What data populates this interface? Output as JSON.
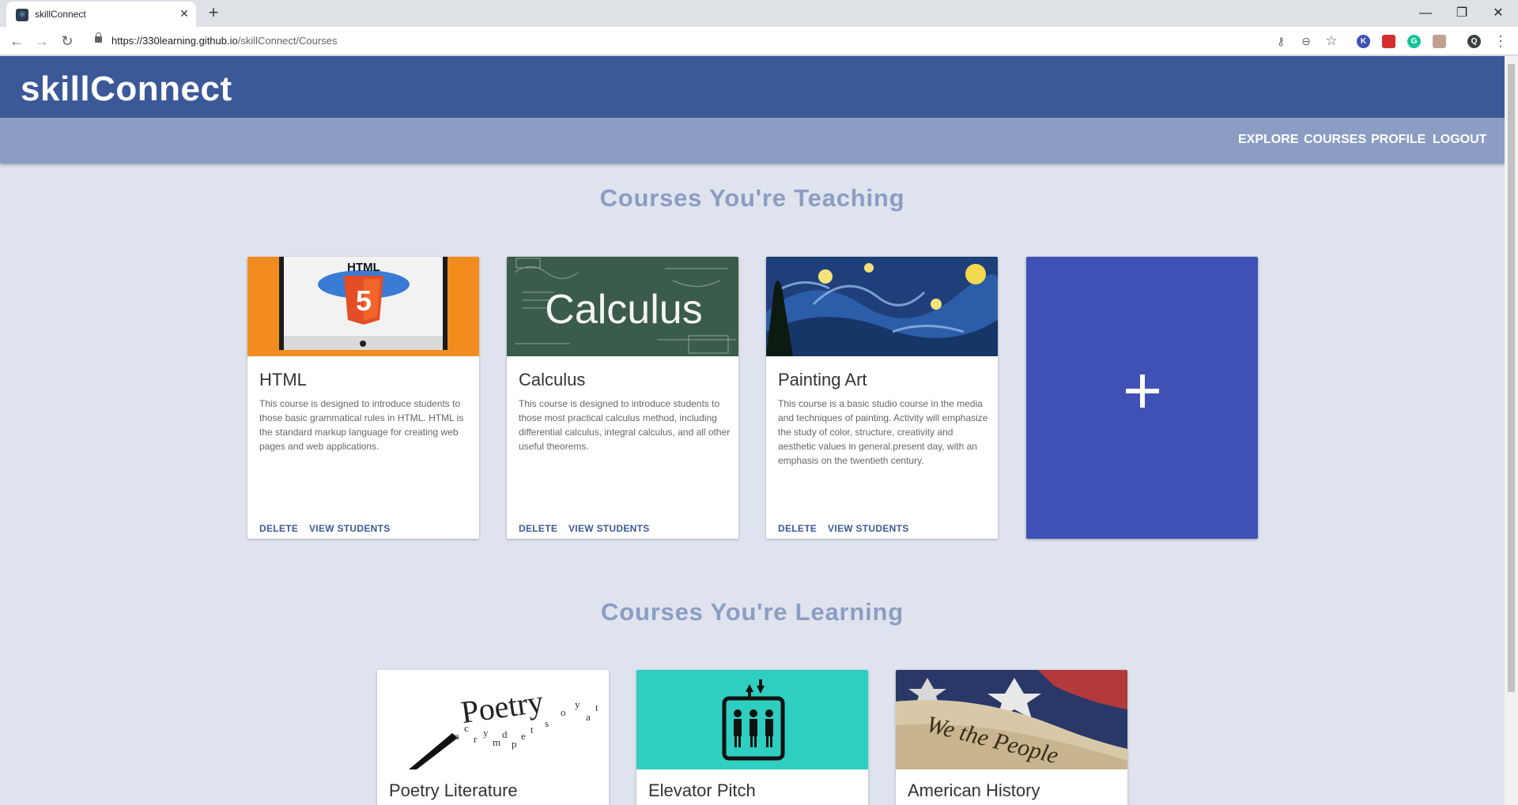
{
  "browser": {
    "tab_title": "skillConnect",
    "tab_close": "✕",
    "new_tab": "+",
    "url_domain": "https://330learning.github.io",
    "url_path": "/skillConnect/Courses",
    "window_controls": {
      "minimize": "—",
      "restore": "❐",
      "close": "✕"
    },
    "extensions": [
      {
        "label": "K",
        "color": "#3f51b5"
      },
      {
        "label": "",
        "color": "#d32f2f"
      },
      {
        "label": "G",
        "color": "#15c39a"
      },
      {
        "label": "",
        "color": "#c0a090"
      },
      {
        "label": "Q",
        "color": "#3c4043"
      }
    ]
  },
  "header": {
    "brand": "skillConnect",
    "menu": [
      "EXPLORE",
      "COURSES",
      "PROFILE",
      "LOGOUT"
    ]
  },
  "teaching": {
    "title": "Courses You're Teaching",
    "courses": [
      {
        "title": "HTML",
        "description": "This course is designed to introduce students to those basic grammatical rules in HTML. HTML is the standard markup language for creating web pages and web applications.",
        "image_label": "HTML",
        "delete_label": "DELETE",
        "view_label": "VIEW STUDENTS"
      },
      {
        "title": "Calculus",
        "description": "This course is designed to introduce students to those most practical calculus method, including differential calculus, integral calculus, and all other useful theorems.",
        "image_label": "Calculus",
        "delete_label": "DELETE",
        "view_label": "VIEW STUDENTS"
      },
      {
        "title": "Painting Art",
        "description": "This course is a basic studio course in the media and techniques of painting. Activity will emphasize the study of color, structure, creativity and aesthetic values in general.present day, with an emphasis on the twentieth century.",
        "delete_label": "DELETE",
        "view_label": "VIEW STUDENTS"
      }
    ],
    "add_label": "+"
  },
  "learning": {
    "title": "Courses You're Learning",
    "courses": [
      {
        "title": "Poetry Literature",
        "image_label": "Poetry"
      },
      {
        "title": "Elevator Pitch"
      },
      {
        "title": "American History",
        "image_label": "We the People"
      }
    ]
  },
  "colors": {
    "brand_bar": "#3b5998",
    "menu_bar": "#8b9dc3",
    "page_bg": "#dfe3ee",
    "add_card": "#3f51b5",
    "button_text": "#3b5998"
  }
}
